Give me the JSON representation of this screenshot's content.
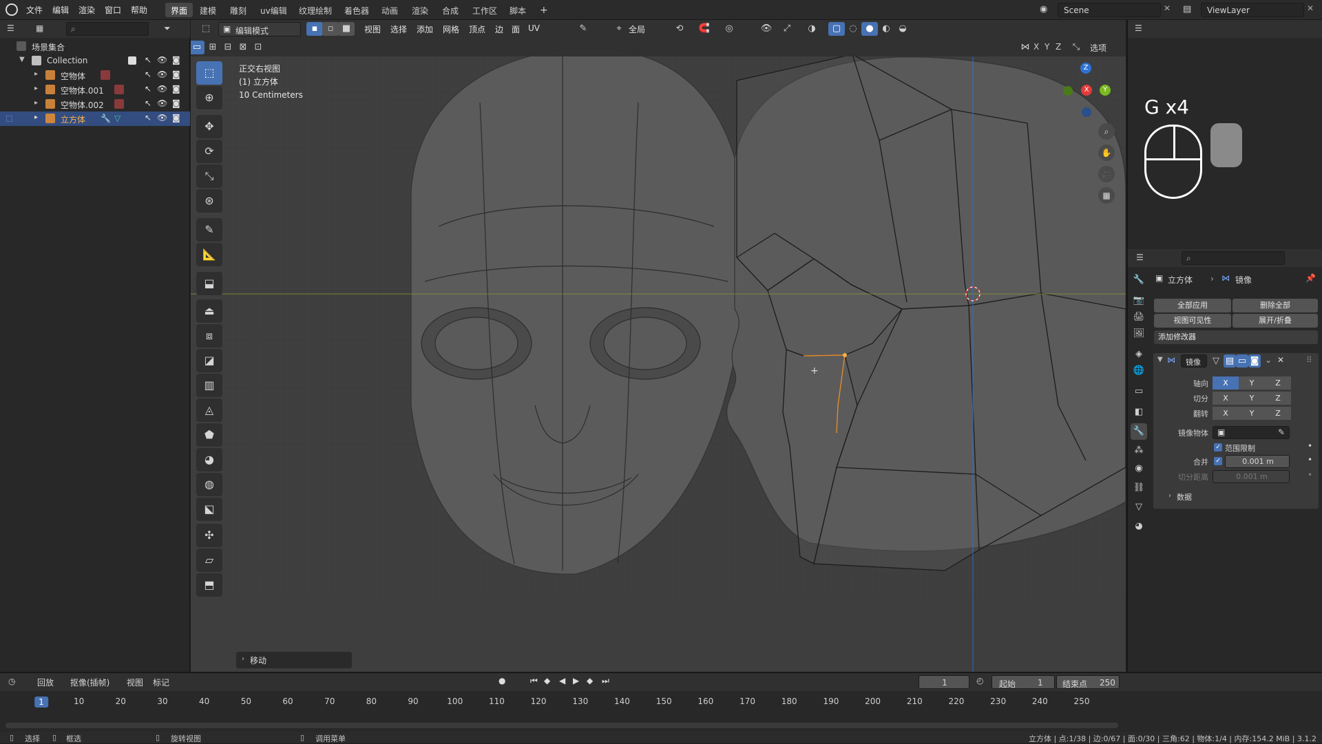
{
  "topbar": {
    "menus": [
      "文件",
      "编辑",
      "渲染",
      "窗口",
      "帮助"
    ],
    "workspaces": [
      "界面",
      "建模",
      "雕刻",
      "uv编辑",
      "纹理绘制",
      "着色器",
      "动画",
      "渲染",
      "合成",
      "工作区",
      "脚本"
    ],
    "active_workspace": "界面",
    "add_tab": "+",
    "scene_label": "Scene",
    "viewlayer_label": "ViewLayer"
  },
  "outliner": {
    "root": "场景集合",
    "collection": "Collection",
    "items": [
      "空物体",
      "空物体.001",
      "空物体.002",
      "立方体"
    ],
    "selected_item": "立方体"
  },
  "viewport_header": {
    "mode": "编辑模式",
    "menus": [
      "视图",
      "选择",
      "添加",
      "网格",
      "顶点",
      "边",
      "面",
      "UV"
    ],
    "transform_orientation": "全局",
    "options_label": "选项",
    "axis_labels": [
      "X",
      "Y",
      "Z"
    ]
  },
  "viewport_info": {
    "view_name": "正交右视图",
    "object": "(1) 立方体",
    "scale": "10 Centimeters"
  },
  "operator_panel": {
    "label": "移动"
  },
  "key_overlay": {
    "text": "G x4"
  },
  "gizmo": {
    "x_label": "X",
    "y_label": "Y",
    "z_label": "Z"
  },
  "properties": {
    "breadcrumb_object": "立方体",
    "breadcrumb_modifier": "镜像",
    "apply_all": "全部应用",
    "delete_all": "删除全部",
    "viewport_visibility": "视图可见性",
    "expand_collapse": "展开/折叠",
    "add_modifier": "添加修改器",
    "modifier_name": "镜像",
    "rows": {
      "axis": "轴向",
      "bisect": "切分",
      "flip": "翻转",
      "mirror_object": "镜像物体",
      "clipping": "范围限制",
      "merge": "合并",
      "bisect_distance": "切分距离"
    },
    "axes": [
      "X",
      "Y",
      "Z"
    ],
    "merge_value": "0.001 m",
    "bisect_value": "0.001 m",
    "data_section": "数据"
  },
  "timeline": {
    "menus": [
      "回放",
      "抠像(插帧)",
      "视图",
      "标记"
    ],
    "current_frame": "1",
    "start_label": "起始",
    "start_value": "1",
    "end_label": "结束点",
    "end_value": "250",
    "ticks": [
      1,
      10,
      20,
      30,
      40,
      50,
      60,
      70,
      80,
      90,
      100,
      110,
      120,
      130,
      140,
      150,
      160,
      170,
      180,
      190,
      200,
      210,
      220,
      230,
      240,
      250
    ]
  },
  "statusbar": {
    "select": "选择",
    "box_select": "框选",
    "rotate_view": "旋转视图",
    "call_menu": "调用菜单",
    "stats": "立方体 | 点:1/38 | 边:0/67 | 面:0/30 | 三角:62 | 物体:1/4 | 内存:154.2 MiB | 3.1.2"
  },
  "colors": {
    "accent": "#4772b3",
    "selected_row": "#334d80",
    "x_axis": "#e33b3b",
    "y_axis": "#7bba1f",
    "z_axis": "#2e72d6"
  }
}
